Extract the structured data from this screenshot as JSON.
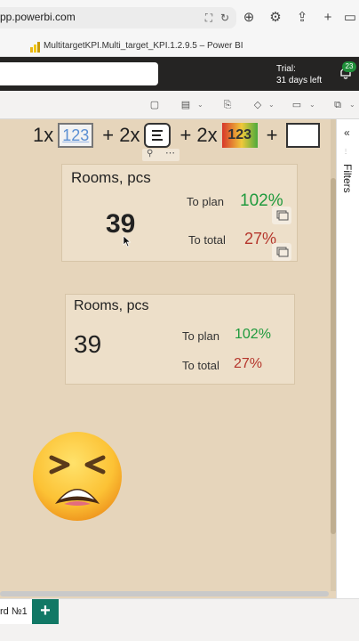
{
  "browser": {
    "url": "pp.powerbi.com",
    "tab_title": "MultitargetKPI.Multi_target_KPI.1.2.9.5 – Power BI"
  },
  "header": {
    "trial_line1": "Trial:",
    "trial_line2": "31 days left",
    "notification_count": "23"
  },
  "formula": {
    "term1": "1x",
    "box1_text": "123",
    "term2": "+ 2x",
    "term3": "+ 2x",
    "box3_text": "123",
    "term4": "+"
  },
  "card1": {
    "title": "Rooms, pcs",
    "value": "39",
    "label_plan": "To plan",
    "pct_plan": "102%",
    "label_total": "To total",
    "pct_total": "27%"
  },
  "card2": {
    "title": "Rooms, pcs",
    "value": "39",
    "label_plan": "To plan",
    "pct_plan": "102%",
    "label_total": "To total",
    "pct_total": "27%"
  },
  "filters": {
    "label": "Filters"
  },
  "pages": {
    "tab_label": "rd №1",
    "add_label": "+"
  },
  "colors": {
    "green": "#1f9a3d",
    "red": "#b5362c",
    "canvas_bg": "#e6d5bb",
    "accent": "#117865"
  }
}
